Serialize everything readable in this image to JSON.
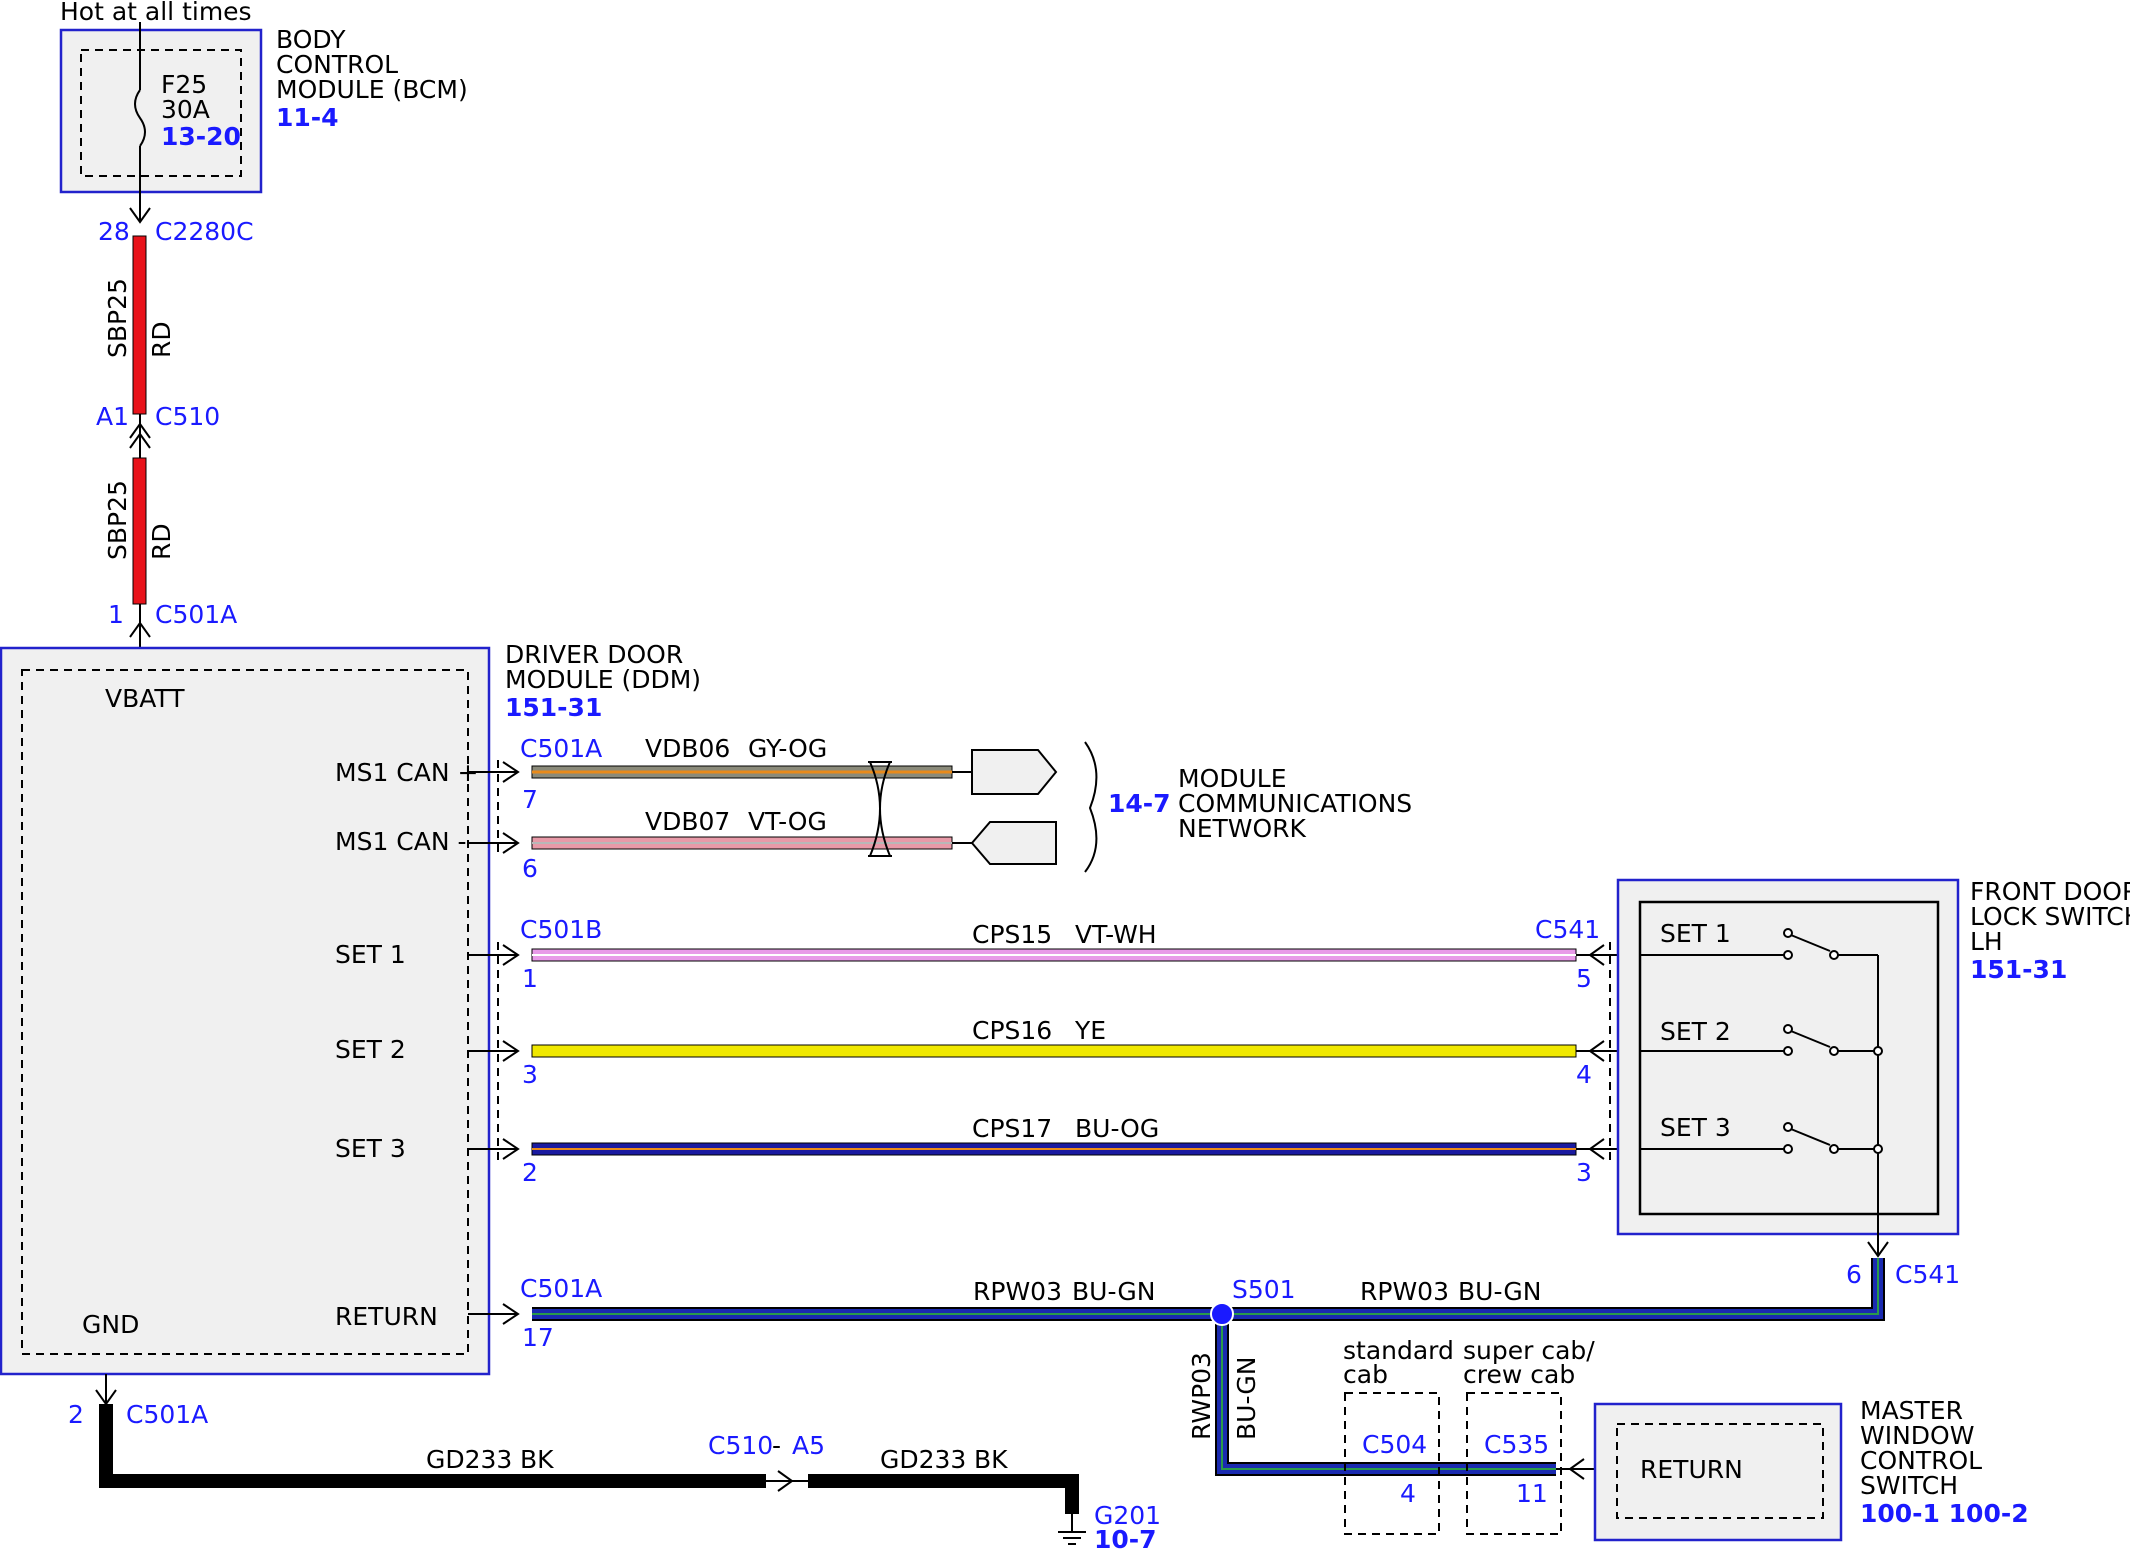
{
  "colors": {
    "reference": "#1a1aff",
    "module_border": "#2222cc",
    "module_fill": "#f0f0f0",
    "RD": "#e8121a",
    "GY-OG": "#8a8a7a",
    "GY-OG_stripe": "#e88a1a",
    "VT-OG": "#e89aa8",
    "VT-WH": "#e89ae8",
    "YE": "#f0e800",
    "BU-OG": "#1a1aa0",
    "BU-GN": "#1a2ab0",
    "BK": "#000000"
  },
  "header": {
    "supply_label": "Hot at all times"
  },
  "bcm": {
    "title_lines": [
      "BODY",
      "CONTROL",
      "MODULE (BCM)"
    ],
    "page_ref": "11-4",
    "fuse_id": "F25",
    "fuse_rating": "30A",
    "fuse_ref": "13-20"
  },
  "wire_sbp25_a": {
    "circuit": "SBP25",
    "color_code": "RD",
    "pin_top": "28",
    "conn_top": "C2280C",
    "pin_bottom": "A1",
    "conn_bottom": "C510"
  },
  "wire_sbp25_b": {
    "circuit": "SBP25",
    "color_code": "RD",
    "pin_bottom": "1",
    "conn_bottom": "C501A"
  },
  "ddm": {
    "title_lines": [
      "DRIVER DOOR",
      "MODULE (DDM)"
    ],
    "page_ref": "151-31",
    "vbatt": "VBATT",
    "gnd": "GND",
    "pins": {
      "ms1_can_plus": "MS1 CAN +",
      "ms1_can_minus": "MS1 CAN -",
      "set1": "SET 1",
      "set2": "SET 2",
      "set3": "SET 3",
      "return": "RETURN"
    }
  },
  "can_bus": {
    "connector": "C501A",
    "plus": {
      "circuit": "VDB06",
      "color_code": "GY-OG",
      "pin": "7"
    },
    "minus": {
      "circuit": "VDB07",
      "color_code": "VT-OG",
      "pin": "6"
    },
    "network_ref": "14-7",
    "network_lines": [
      "MODULE",
      "COMMUNICATIONS",
      "NETWORK"
    ]
  },
  "set_wires": {
    "ddm_connector": "C501B",
    "switch_connector": "C541",
    "set1": {
      "circuit": "CPS15",
      "color_code": "VT-WH",
      "pin_ddm": "1",
      "pin_switch": "5"
    },
    "set2": {
      "circuit": "CPS16",
      "color_code": "YE",
      "pin_ddm": "3",
      "pin_switch": "4"
    },
    "set3": {
      "circuit": "CPS17",
      "color_code": "BU-OG",
      "pin_ddm": "2",
      "pin_switch": "3"
    }
  },
  "lock_switch": {
    "title_lines": [
      "FRONT DOOR",
      "LOCK SWITCH",
      "LH"
    ],
    "page_ref": "151-31",
    "labels": [
      "SET 1",
      "SET 2",
      "SET 3"
    ],
    "pin_bottom": "6",
    "conn_bottom": "C541"
  },
  "return_wire": {
    "connector": "C501A",
    "pin": "17",
    "circuit": "RPW03",
    "color_code": "BU-GN",
    "splice": "S501",
    "circuit_right": "RPW03",
    "color_code_right": "BU-GN",
    "branch_circuit": "RWP03",
    "branch_color": "BU-GN"
  },
  "cab_options": {
    "standard": {
      "label_lines": [
        "standard",
        "cab"
      ],
      "connector": "C504",
      "pin": "4"
    },
    "super": {
      "label_lines": [
        "super cab/",
        "crew cab"
      ],
      "connector": "C535",
      "pin": "11"
    }
  },
  "master_switch": {
    "title_lines": [
      "MASTER",
      "WINDOW",
      "CONTROL",
      "SWITCH"
    ],
    "page_ref": "100-1 100-2",
    "pin_label": "RETURN"
  },
  "ground": {
    "pin": "2",
    "connector": "C501A",
    "circuit": "GD233",
    "color_code": "BK",
    "inline_conn": "C510",
    "inline_dash": "-",
    "inline_pin": "A5",
    "circuit_right": "GD233",
    "color_code_right": "BK",
    "ground_id": "G201",
    "ground_ref": "10-7"
  }
}
